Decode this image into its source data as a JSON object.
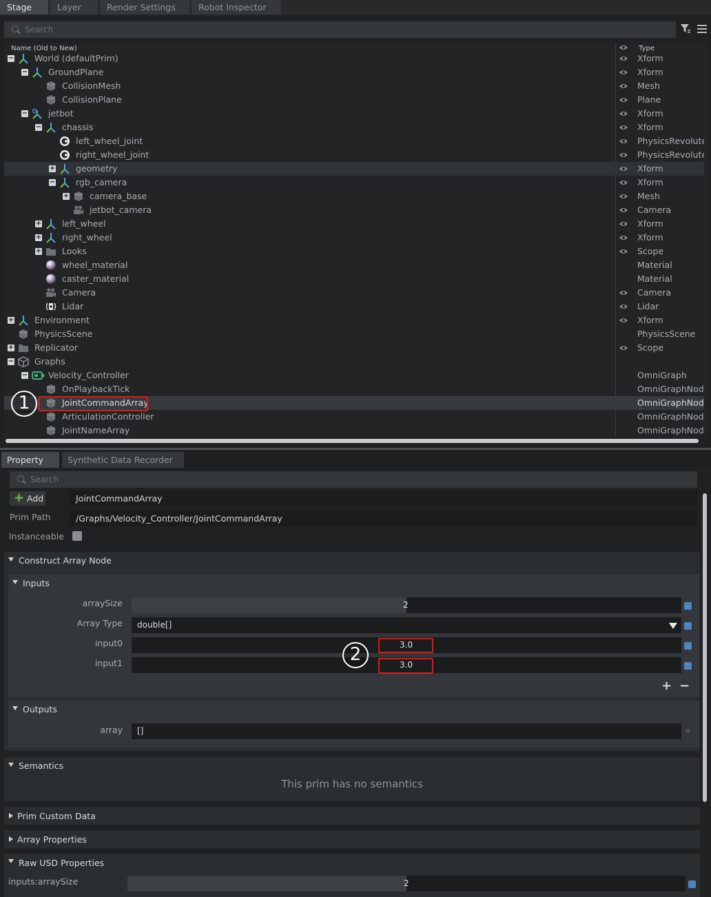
{
  "top_tabs": [
    "Stage",
    "Layer",
    "Render Settings",
    "Robot Inspector"
  ],
  "stage": {
    "search_placeholder": "Search",
    "header_name": "Name (Old to New)",
    "header_type": "Type",
    "rows": [
      {
        "label": "World (defaultPrim)",
        "type": "Xform",
        "depth": 0,
        "expander": "minus",
        "icon": "xform-icon",
        "eye": true
      },
      {
        "label": "GroundPlane",
        "type": "Xform",
        "depth": 1,
        "expander": "minus",
        "icon": "xform-icon",
        "eye": true
      },
      {
        "label": "CollisionMesh",
        "type": "Mesh",
        "depth": 2,
        "expander": "",
        "icon": "mesh-icon",
        "eye": true
      },
      {
        "label": "CollisionPlane",
        "type": "Plane",
        "depth": 2,
        "expander": "",
        "icon": "mesh-icon",
        "eye": true
      },
      {
        "label": "jetbot",
        "type": "Xform",
        "depth": 1,
        "expander": "minus",
        "icon": "robot-xform-icon",
        "eye": true
      },
      {
        "label": "chassis",
        "type": "Xform",
        "depth": 2,
        "expander": "minus",
        "icon": "xform-icon",
        "eye": true
      },
      {
        "label": "left_wheel_joint",
        "type": "PhysicsRevoluteJ",
        "depth": 3,
        "expander": "",
        "icon": "joint-icon",
        "eye": true
      },
      {
        "label": "right_wheel_joint",
        "type": "PhysicsRevoluteJ",
        "depth": 3,
        "expander": "",
        "icon": "joint-icon",
        "eye": true
      },
      {
        "label": "geometry",
        "type": "Xform",
        "depth": 3,
        "expander": "plus",
        "icon": "xform-icon",
        "eye": true,
        "state": "selected"
      },
      {
        "label": "rgb_camera",
        "type": "Xform",
        "depth": 3,
        "expander": "minus",
        "icon": "xform-icon",
        "eye": true
      },
      {
        "label": "camera_base",
        "type": "Mesh",
        "depth": 4,
        "expander": "plus",
        "icon": "mesh-icon",
        "eye": true
      },
      {
        "label": "jetbot_camera",
        "type": "Camera",
        "depth": 4,
        "expander": "",
        "icon": "camera-icon",
        "eye": true
      },
      {
        "label": "left_wheel",
        "type": "Xform",
        "depth": 2,
        "expander": "plus",
        "icon": "xform-icon",
        "eye": true
      },
      {
        "label": "right_wheel",
        "type": "Xform",
        "depth": 2,
        "expander": "plus",
        "icon": "xform-icon",
        "eye": true
      },
      {
        "label": "Looks",
        "type": "Scope",
        "depth": 2,
        "expander": "plus",
        "icon": "folder-icon",
        "eye": true
      },
      {
        "label": "wheel_material",
        "type": "Material",
        "depth": 2,
        "expander": "",
        "icon": "material-icon",
        "eye": false
      },
      {
        "label": "caster_material",
        "type": "Material",
        "depth": 2,
        "expander": "",
        "icon": "material-icon",
        "eye": false
      },
      {
        "label": "Camera",
        "type": "Camera",
        "depth": 2,
        "expander": "",
        "icon": "camera-icon",
        "eye": true
      },
      {
        "label": "Lidar",
        "type": "Lidar",
        "depth": 2,
        "expander": "",
        "icon": "lidar-icon",
        "eye": true
      },
      {
        "label": "Environment",
        "type": "Xform",
        "depth": 0,
        "expander": "plus",
        "icon": "xform-icon",
        "eye": true
      },
      {
        "label": "PhysicsScene",
        "type": "PhysicsScene",
        "depth": 0,
        "expander": "",
        "icon": "mesh-icon",
        "eye": false
      },
      {
        "label": "Replicator",
        "type": "Scope",
        "depth": 0,
        "expander": "plus",
        "icon": "folder-icon",
        "eye": true
      },
      {
        "label": "Graphs",
        "type": "",
        "depth": 0,
        "expander": "minus",
        "icon": "graph-folder-icon",
        "eye": false
      },
      {
        "label": "Velocity_Controller",
        "type": "OmniGraph",
        "depth": 1,
        "expander": "minus",
        "icon": "omnigraph-icon",
        "eye": false
      },
      {
        "label": "OnPlaybackTick",
        "type": "OmniGraphNode",
        "depth": 2,
        "expander": "",
        "icon": "mesh-icon",
        "eye": false
      },
      {
        "label": "JointCommandArray",
        "type": "OmniGraphNode",
        "depth": 2,
        "expander": "",
        "icon": "mesh-icon",
        "eye": false,
        "state": "highlight"
      },
      {
        "label": "ArticulationController",
        "type": "OmniGraphNode",
        "depth": 2,
        "expander": "",
        "icon": "mesh-icon",
        "eye": false
      },
      {
        "label": "JointNameArray",
        "type": "OmniGraphNode",
        "depth": 2,
        "expander": "",
        "icon": "mesh-icon",
        "eye": false
      }
    ]
  },
  "annotations": {
    "badge1": "1",
    "badge2": "2"
  },
  "property_tabs": [
    "Property",
    "Synthetic Data Recorder"
  ],
  "property": {
    "search_placeholder": "Search",
    "add_label": "Add",
    "prim_name": "JointCommandArray",
    "prim_path_label": "Prim Path",
    "prim_path": "/Graphs/Velocity_Controller/JointCommandArray",
    "instanceable_label": "Instanceable",
    "construct_section": "Construct Array Node",
    "inputs_section": "Inputs",
    "array_size_label": "arraySize",
    "array_size_value": "2",
    "array_type_label": "Array Type",
    "array_type_value": "double[]",
    "input0_label": "input0",
    "input0_value": "3.0",
    "input1_label": "input1",
    "input1_value": "3.0",
    "outputs_section": "Outputs",
    "array_label": "array",
    "array_value": "[]",
    "semantics_section": "Semantics",
    "no_semantics": "This prim has no semantics",
    "prim_custom_data": "Prim Custom Data",
    "array_properties": "Array Properties",
    "raw_usd": "Raw USD Properties",
    "raw_array_size_label": "inputs:arraySize",
    "raw_array_size_value": "2"
  },
  "colors": {
    "accent_blue": "#4e85bf",
    "annotation_red": "#e01818",
    "add_green": "#7ac143"
  }
}
